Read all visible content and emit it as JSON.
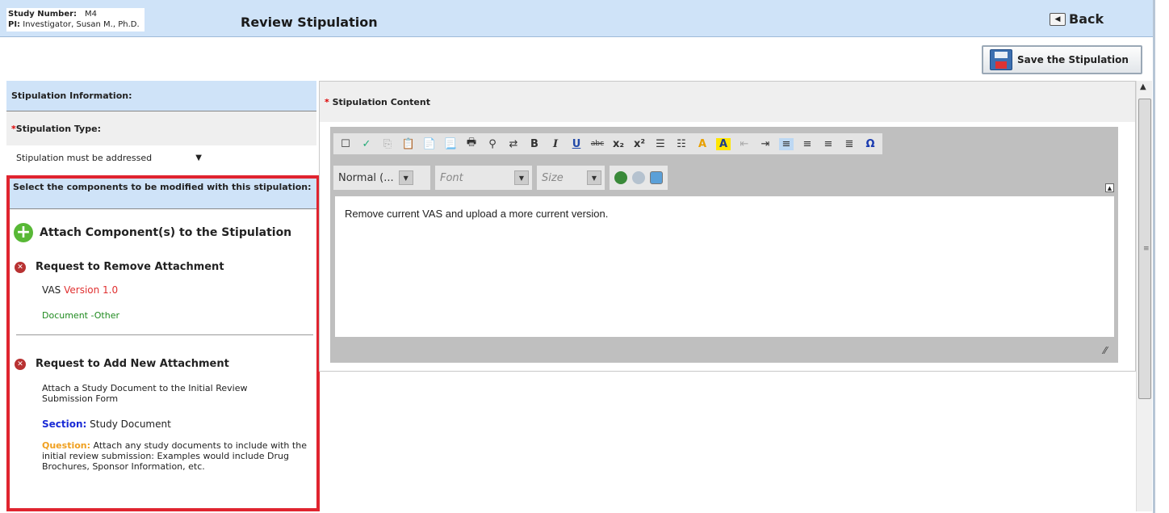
{
  "header": {
    "study_number_label": "Study Number:",
    "study_number": "M4",
    "pi_label": "PI:",
    "pi": "Investigator, Susan M., Ph.D.",
    "title": "Review Stipulation",
    "back_label": "Back"
  },
  "save_button": {
    "label": "Save the Stipulation"
  },
  "left": {
    "info_heading": "Stipulation Information:",
    "type_label": "Stipulation Type:",
    "type_required_mark": "*",
    "type_value": "Stipulation must be addressed",
    "components_heading": "Select the components to be modified with this stipulation:",
    "attach_label": "Attach Component(s) to the Stipulation",
    "remove_request": {
      "title": "Request to Remove Attachment",
      "doc_name": "VAS",
      "version": "Version 1.0",
      "doc_type": "Document -Other"
    },
    "add_request": {
      "title": "Request to Add New Attachment",
      "description": "Attach a Study Document to the Initial Review Submission Form",
      "section_label": "Section:",
      "section_value": "Study Document",
      "question_label": "Question:",
      "question_value": "Attach any study documents to include with the initial review submission: Examples would include Drug Brochures, Sponsor Information, etc."
    }
  },
  "content": {
    "required_mark": "*",
    "heading": "Stipulation Content",
    "format_value": "Normal (...",
    "font_placeholder": "Font",
    "size_placeholder": "Size",
    "body_text": "Remove current VAS and upload a more current version."
  },
  "icons": [
    "back-icon",
    "floppy-icon",
    "plus-icon",
    "remove-icon",
    "spellcheck-icon",
    "bold-icon",
    "italic-icon",
    "underline-icon",
    "omega-icon"
  ],
  "colors": {
    "header_bg": "#cfe3f8",
    "highlight_border": "#e0242f",
    "version_red": "#e03030",
    "doctype_green": "#1f8a1f",
    "section_blue": "#1a2bd6",
    "question_orange": "#f0a020"
  }
}
